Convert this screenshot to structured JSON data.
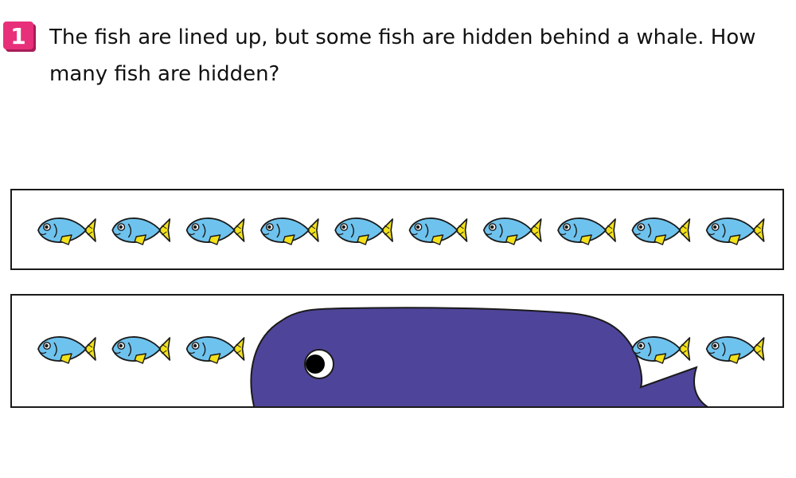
{
  "question": {
    "number": "1",
    "text": "The fish are lined up, but some fish are hidden behind a whale. How many fish are hidden?"
  },
  "colors": {
    "badge": "#e8307a",
    "fish_body": "#6ec3ee",
    "fish_fin": "#f3e11a",
    "whale": "#4e459a",
    "outline": "#1a1a1a"
  },
  "scene": {
    "top_row_fish_count": 10,
    "bottom_row_visible_fish_count": 5,
    "bottom_row_left_fish": 3,
    "bottom_row_right_fish": 2,
    "hiding_object": "whale"
  }
}
